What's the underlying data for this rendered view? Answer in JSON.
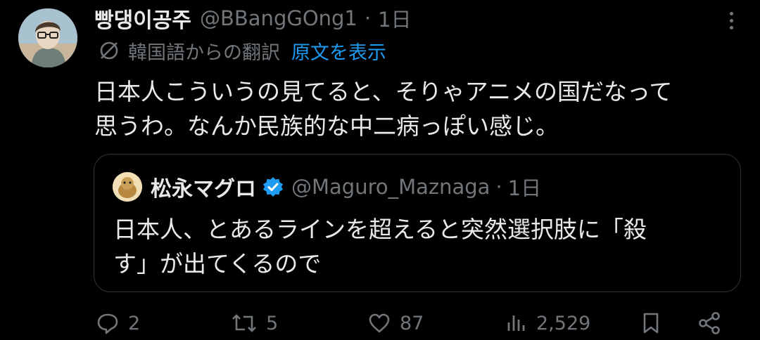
{
  "tweet": {
    "author_name": "빵댕이공주",
    "handle": "@BBangGOng1",
    "separator": "·",
    "time": "1日",
    "translation_note": "韓国語からの翻訳",
    "show_original": "原文を表示",
    "text": "日本人こういうの見てると、そりゃアニメの国だなって\n思うわ。なんか民族的な中二病っぽい感じ。"
  },
  "quote": {
    "author_name": "松永マグロ",
    "handle": "@Maguro_Maznaga",
    "separator": "·",
    "time": "1日",
    "text": "日本人、とあるラインを超えると突然選択肢に「殺\nす」が出てくるので"
  },
  "actions": {
    "replies": "2",
    "retweets": "5",
    "likes": "87",
    "views": "2,529"
  },
  "icons": [
    "more-icon",
    "translate-icon",
    "verified-icon",
    "reply-icon",
    "retweet-icon",
    "like-icon",
    "views-icon",
    "bookmark-icon",
    "share-icon"
  ],
  "colors": {
    "background": "#000000",
    "text": "#e7e9ea",
    "muted": "#71767b",
    "accent": "#1d9bf0",
    "border": "#2f3336"
  }
}
